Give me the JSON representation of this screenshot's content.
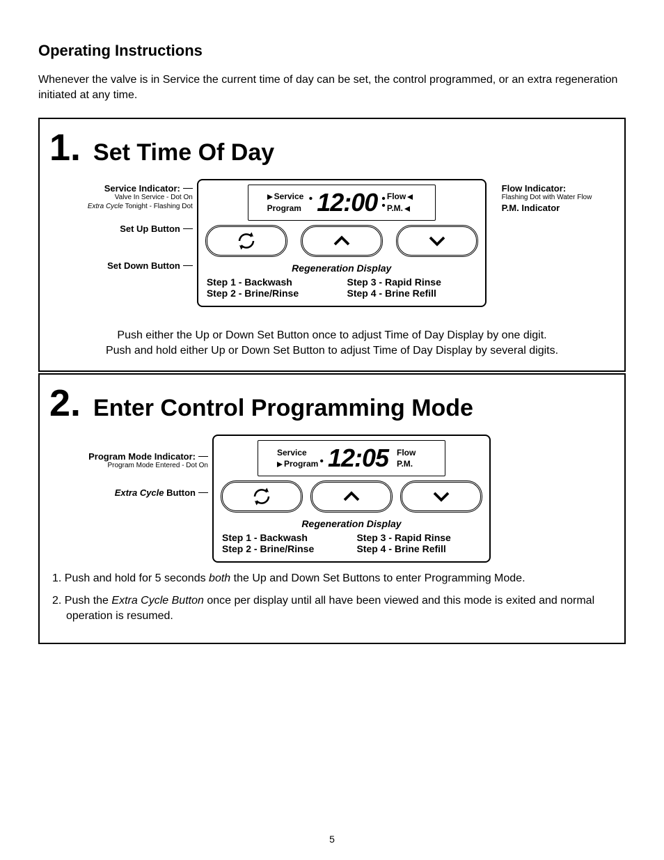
{
  "page_title": "Operating Instructions",
  "intro": "Whenever the valve is in Service the current time of day can be set, the control programmed, or an extra regeneration initiated at any time.",
  "page_number": "5",
  "section1": {
    "number": "1.",
    "title": "Set Time Of Day",
    "left": {
      "service_ind_title": "Service Indicator:",
      "service_ind_line1": "Valve In Service - Dot On",
      "service_ind_line2_pre": "Extra Cycle",
      "service_ind_line2_post": " Tonight - Flashing Dot",
      "set_up": "Set Up Button",
      "set_down": "Set Down Button"
    },
    "lcd": {
      "service": "Service",
      "program": "Program",
      "flow": "Flow",
      "pm": "P.M.",
      "time": "12:00"
    },
    "right": {
      "flow_title": "Flow Indicator:",
      "flow_sub": "Flashing Dot with Water Flow",
      "pm_ind": "P.M. Indicator"
    },
    "regen": {
      "title": "Regeneration Display",
      "s1": "Step 1 - Backwash",
      "s2": "Step 2 - Brine/Rinse",
      "s3": "Step 3 - Rapid Rinse",
      "s4": "Step 4 - Brine Refill"
    },
    "para_l1": "Push either the Up or Down Set Button once to adjust Time of Day Display by one digit.",
    "para_l2": "Push and hold either Up or Down Set Button to adjust Time of Day Display by several digits."
  },
  "section2": {
    "number": "2.",
    "title": "Enter Control Programming Mode",
    "left": {
      "prog_title": "Program Mode Indicator:",
      "prog_sub": "Program Mode Entered - Dot On",
      "extra_pre": "Extra Cycle",
      "extra_post": " Button"
    },
    "lcd": {
      "service": "Service",
      "program": "Program",
      "flow": "Flow",
      "pm": "P.M.",
      "time": "12:05"
    },
    "regen": {
      "title": "Regeneration Display",
      "s1": "Step 1 - Backwash",
      "s2": "Step 2 - Brine/Rinse",
      "s3": "Step 3 - Rapid Rinse",
      "s4": "Step 4 - Brine Refill"
    },
    "list": {
      "i1_pre": "1. Push and hold for 5 seconds ",
      "i1_em": "both",
      "i1_post": " the Up and Down Set Buttons to enter Programming Mode.",
      "i2_pre": "2. Push the ",
      "i2_em": "Extra Cycle Button",
      "i2_post": " once per display until all have been viewed and this mode is exited and normal operation is resumed."
    }
  }
}
